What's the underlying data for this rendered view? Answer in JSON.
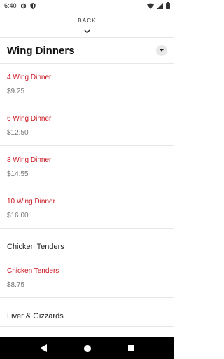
{
  "status_bar": {
    "time": "6:40",
    "icons": [
      "gear-icon",
      "shield-icon",
      "wifi-icon",
      "signal-icon",
      "battery-icon"
    ]
  },
  "header": {
    "back_label": "BACK"
  },
  "section": {
    "title": "Wing Dinners"
  },
  "items": [
    {
      "name": "4 Wing Dinner",
      "price": "$9.25"
    },
    {
      "name": "6 Wing Dinner",
      "price": "$12.50"
    },
    {
      "name": "8 Wing Dinner",
      "price": "$14.55"
    },
    {
      "name": "10 Wing Dinner",
      "price": "$16.00"
    }
  ],
  "subsections": [
    {
      "title": "Chicken Tenders",
      "items": [
        {
          "name": "Chicken Tenders",
          "price": "$8.75"
        }
      ]
    },
    {
      "title": "Liver & Gizzards",
      "items": []
    }
  ],
  "colors": {
    "item_name": "#c8141e",
    "price": "#777777",
    "nav_bar": "#000000"
  }
}
